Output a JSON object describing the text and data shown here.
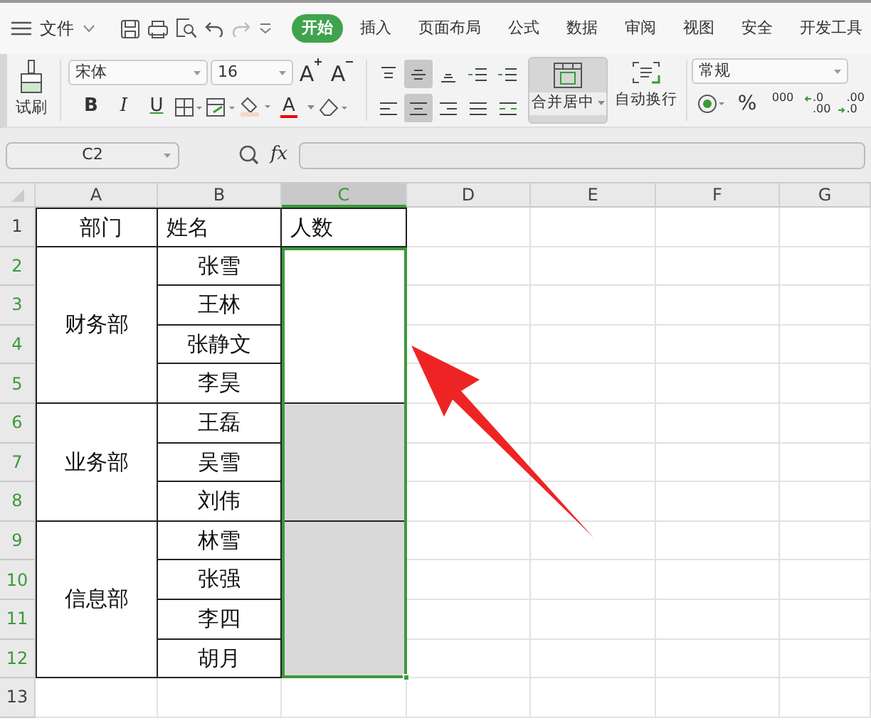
{
  "menu_bar": {
    "file_menu": "文件",
    "tabs": [
      {
        "label": "开始",
        "selected": true
      },
      {
        "label": "插入",
        "selected": false
      },
      {
        "label": "页面布局",
        "selected": false
      },
      {
        "label": "公式",
        "selected": false
      },
      {
        "label": "数据",
        "selected": false
      },
      {
        "label": "审阅",
        "selected": false
      },
      {
        "label": "视图",
        "selected": false
      },
      {
        "label": "安全",
        "selected": false
      },
      {
        "label": "开发工具",
        "selected": false
      }
    ]
  },
  "ribbon": {
    "format_painter": "试刷",
    "font_name": "宋体",
    "font_size": "16",
    "font_size_buttons": [
      {
        "kind": "grow",
        "label": "A"
      },
      {
        "kind": "shrink",
        "label": "A"
      }
    ],
    "style_buttons": [
      {
        "kind": "bold",
        "label": "B"
      },
      {
        "kind": "italic",
        "label": "I"
      },
      {
        "kind": "underline",
        "label": "U"
      }
    ],
    "font_color_label": "A",
    "align_buttons": [
      {
        "kind": "top",
        "selected": false
      },
      {
        "kind": "middle",
        "selected": true
      },
      {
        "kind": "bottom",
        "selected": false
      },
      {
        "kind": "outdent",
        "selected": false
      },
      {
        "kind": "indent",
        "selected": false
      },
      {
        "kind": "left",
        "selected": false
      },
      {
        "kind": "center",
        "selected": true
      },
      {
        "kind": "right",
        "selected": false
      },
      {
        "kind": "justify",
        "selected": false
      },
      {
        "kind": "distributed",
        "selected": false
      }
    ],
    "merge_center": "合并居中",
    "wrap_text": "自动换行",
    "number_format": "常规",
    "percent": "%",
    "thousands": "000",
    "decimal_buttons": [
      {
        "kind": "increase",
        "top": ".0",
        "bottom": ".00"
      },
      {
        "kind": "decrease",
        "top": ".00",
        "bottom": ".0"
      }
    ]
  },
  "formula_bar": {
    "name_box": "C2",
    "fx": "fx"
  },
  "sheet": {
    "columns": [
      {
        "label": "A",
        "selected": false
      },
      {
        "label": "B",
        "selected": false
      },
      {
        "label": "C",
        "selected": true
      },
      {
        "label": "D",
        "selected": false
      },
      {
        "label": "E",
        "selected": false
      },
      {
        "label": "F",
        "selected": false
      },
      {
        "label": "G",
        "selected": false
      }
    ],
    "rows": [
      {
        "label": "1",
        "selected": false
      },
      {
        "label": "2",
        "selected": true
      },
      {
        "label": "3",
        "selected": true
      },
      {
        "label": "4",
        "selected": true
      },
      {
        "label": "5",
        "selected": true
      },
      {
        "label": "6",
        "selected": true
      },
      {
        "label": "7",
        "selected": true
      },
      {
        "label": "8",
        "selected": true
      },
      {
        "label": "9",
        "selected": true
      },
      {
        "label": "10",
        "selected": true
      },
      {
        "label": "11",
        "selected": true
      },
      {
        "label": "12",
        "selected": true
      },
      {
        "label": "13",
        "selected": false
      }
    ],
    "header": [
      "部门",
      "姓名",
      "人数"
    ],
    "groups": [
      {
        "department": "财务部",
        "names": [
          "张雪",
          "王林",
          "张静文",
          "李昊"
        ],
        "active": true
      },
      {
        "department": "业务部",
        "names": [
          "王磊",
          "吴雪",
          "刘伟"
        ],
        "active": false
      },
      {
        "department": "信息部",
        "names": [
          "林雪",
          "张强",
          "李四",
          "胡月"
        ],
        "active": false
      }
    ]
  }
}
